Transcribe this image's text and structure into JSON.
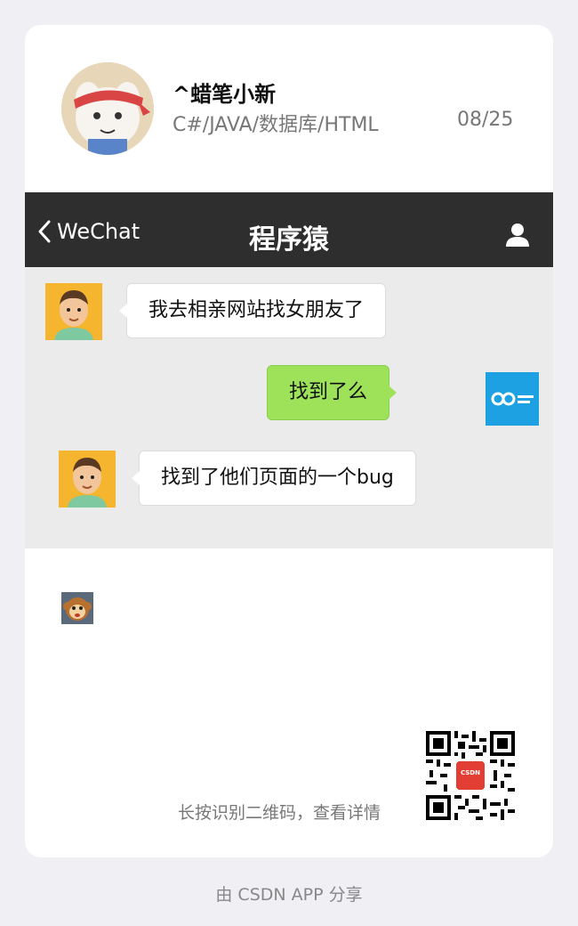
{
  "author": {
    "name": "^蜡笔小新",
    "bio": "C#/JAVA/数据库/HTML",
    "date": "08/25"
  },
  "wechat": {
    "back_label": "WeChat",
    "title": "程序猿",
    "messages": [
      {
        "side": "left",
        "text": "我去相亲网站找女朋友了"
      },
      {
        "side": "right",
        "text": "找到了么"
      },
      {
        "side": "left",
        "text": "找到了他们页面的一个bug"
      }
    ]
  },
  "qr": {
    "caption": "长按识别二维码，查看详情",
    "badge": "CSDN"
  },
  "footer": "由 CSDN APP 分享",
  "colors": {
    "background": "#efeff4",
    "navbar": "#2e2e2e",
    "chat_bg": "#ebebeb",
    "sent_bubble": "#9ee25a",
    "brand_red": "#e33e33"
  }
}
